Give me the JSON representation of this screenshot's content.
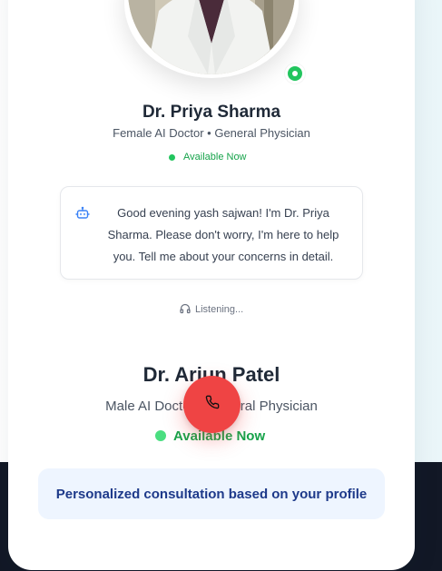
{
  "doctor_primary": {
    "name": "Dr. Priya Sharma",
    "subtitle": "Female AI Doctor • General Physician",
    "status": "Available Now"
  },
  "message": {
    "text": "Good evening yash sajwan! I'm Dr. Priya Sharma. Please don't worry, I'm here to help you. Tell me about your concerns in detail."
  },
  "listening": {
    "label": "Listening..."
  },
  "doctor_secondary": {
    "name": "Dr. Arjun Patel",
    "subtitle": "Male AI Doctor • General Physician",
    "status": "Available Now"
  },
  "info": {
    "text": "Personalized consultation based on your profile"
  },
  "icons": {
    "bot": "robot-icon",
    "headphones": "headphones-icon",
    "call": "phone-icon"
  },
  "colors": {
    "status_green": "#22c55e",
    "end_call_red": "#ef4444",
    "info_text": "#1e3a8a"
  }
}
